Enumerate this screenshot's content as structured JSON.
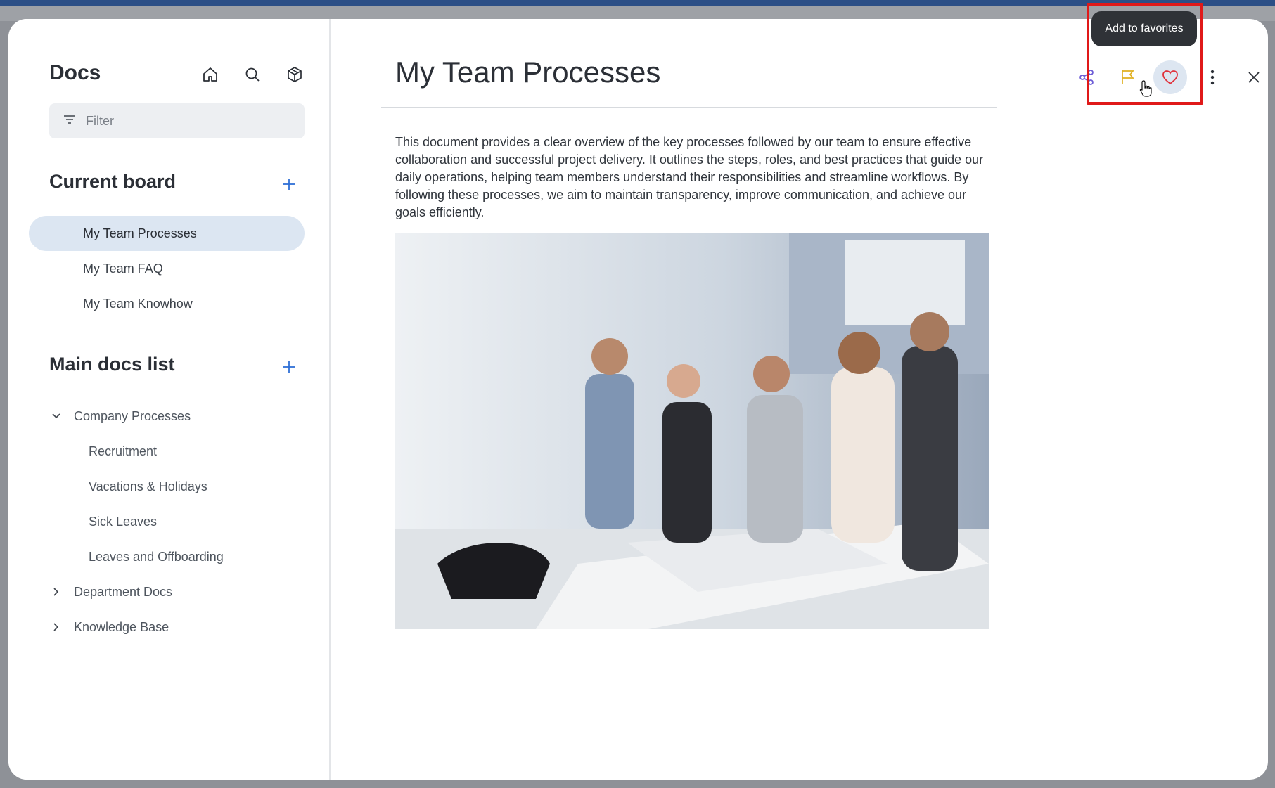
{
  "sidebar": {
    "app_title": "Docs",
    "header_icons": [
      "home-icon",
      "search-icon",
      "cube-icon"
    ],
    "filter": {
      "placeholder": "Filter",
      "value": ""
    },
    "current_board": {
      "title": "Current board",
      "items": [
        {
          "label": "My Team Processes",
          "active": true
        },
        {
          "label": "My Team FAQ",
          "active": false
        },
        {
          "label": "My Team Knowhow",
          "active": false
        }
      ]
    },
    "main_docs": {
      "title": "Main docs list",
      "tree": [
        {
          "label": "Company Processes",
          "expanded": true,
          "children": [
            "Recruitment",
            "Vacations & Holidays",
            "Sick Leaves",
            "Leaves and Offboarding"
          ]
        },
        {
          "label": "Department Docs",
          "expanded": false
        },
        {
          "label": "Knowledge Base",
          "expanded": false
        }
      ]
    }
  },
  "document": {
    "title": "My Team Processes",
    "body": "This document provides a clear overview of the key processes followed by our team to ensure effective collaboration and successful project delivery. It outlines the steps, roles, and best practices that guide our daily operations, helping team members understand their responsibilities and streamline workflows. By following these processes, we aim to maintain transparency, improve communication, and achieve our goals efficiently."
  },
  "toolbar": {
    "icons": [
      "share-icon",
      "flag-icon",
      "heart-icon",
      "more-vertical-icon",
      "close-icon"
    ],
    "tooltip": "Add to favorites"
  },
  "colors": {
    "accent": "#2f6fd6",
    "share": "#6b5bd6",
    "flag": "#e0b020",
    "heart": "#e0303a",
    "highlight": "#e01919"
  }
}
